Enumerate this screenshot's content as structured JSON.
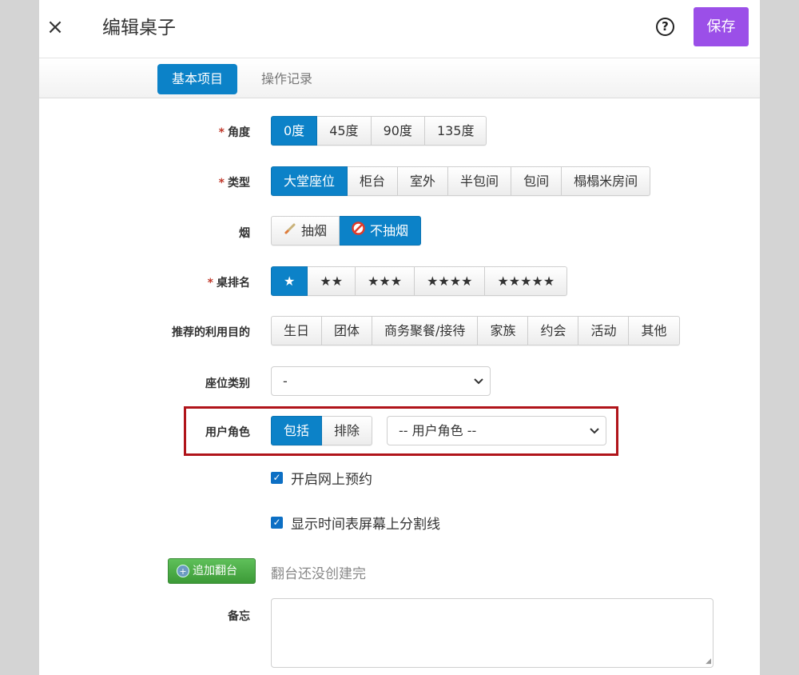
{
  "header": {
    "close_label": "×",
    "title": "编辑桌子",
    "help_label": "?",
    "save_label": "保存"
  },
  "tabs": [
    {
      "label": "基本项目",
      "active": true
    },
    {
      "label": "操作记录",
      "active": false
    }
  ],
  "form": {
    "angle": {
      "label": "角度",
      "required": "*",
      "options": [
        "0度",
        "45度",
        "90度",
        "135度"
      ],
      "selected": "0度"
    },
    "type": {
      "label": "类型",
      "required": "*",
      "options": [
        "大堂座位",
        "柜台",
        "室外",
        "半包间",
        "包间",
        "榻榻米房间"
      ],
      "selected": "大堂座位"
    },
    "smoke": {
      "label": "烟",
      "options": [
        "抽烟",
        "不抽烟"
      ],
      "icons": [
        "cigarette-icon",
        "no-smoking-icon"
      ],
      "selected": "不抽烟"
    },
    "rank": {
      "label": "桌排名",
      "required": "*",
      "options": [
        "★",
        "★★",
        "★★★",
        "★★★★",
        "★★★★★"
      ],
      "selected": "★"
    },
    "purpose": {
      "label": "推荐的利用目的",
      "options": [
        "生日",
        "团体",
        "商务聚餐/接待",
        "家族",
        "约会",
        "活动",
        "其他"
      ]
    },
    "seat_category": {
      "label": "座位类别",
      "value": "-"
    },
    "user_role": {
      "label": "用户角色",
      "options": [
        "包括",
        "排除"
      ],
      "selected": "包括",
      "select_value": "-- 用户角色 --"
    },
    "online_booking": {
      "label": "开启网上预约",
      "checked": true
    },
    "timeline_divider": {
      "label": "显示时间表屏幕上分割线",
      "checked": true
    },
    "add_turnover": {
      "label": "追加翻台",
      "note": "翻台还没创建完"
    },
    "memo": {
      "label": "备忘",
      "value": ""
    }
  },
  "colors": {
    "accent_blue": "#0c82c8",
    "save_purple": "#9b4fe8",
    "add_green": "#4cad47",
    "highlight_red": "#b0141a"
  }
}
